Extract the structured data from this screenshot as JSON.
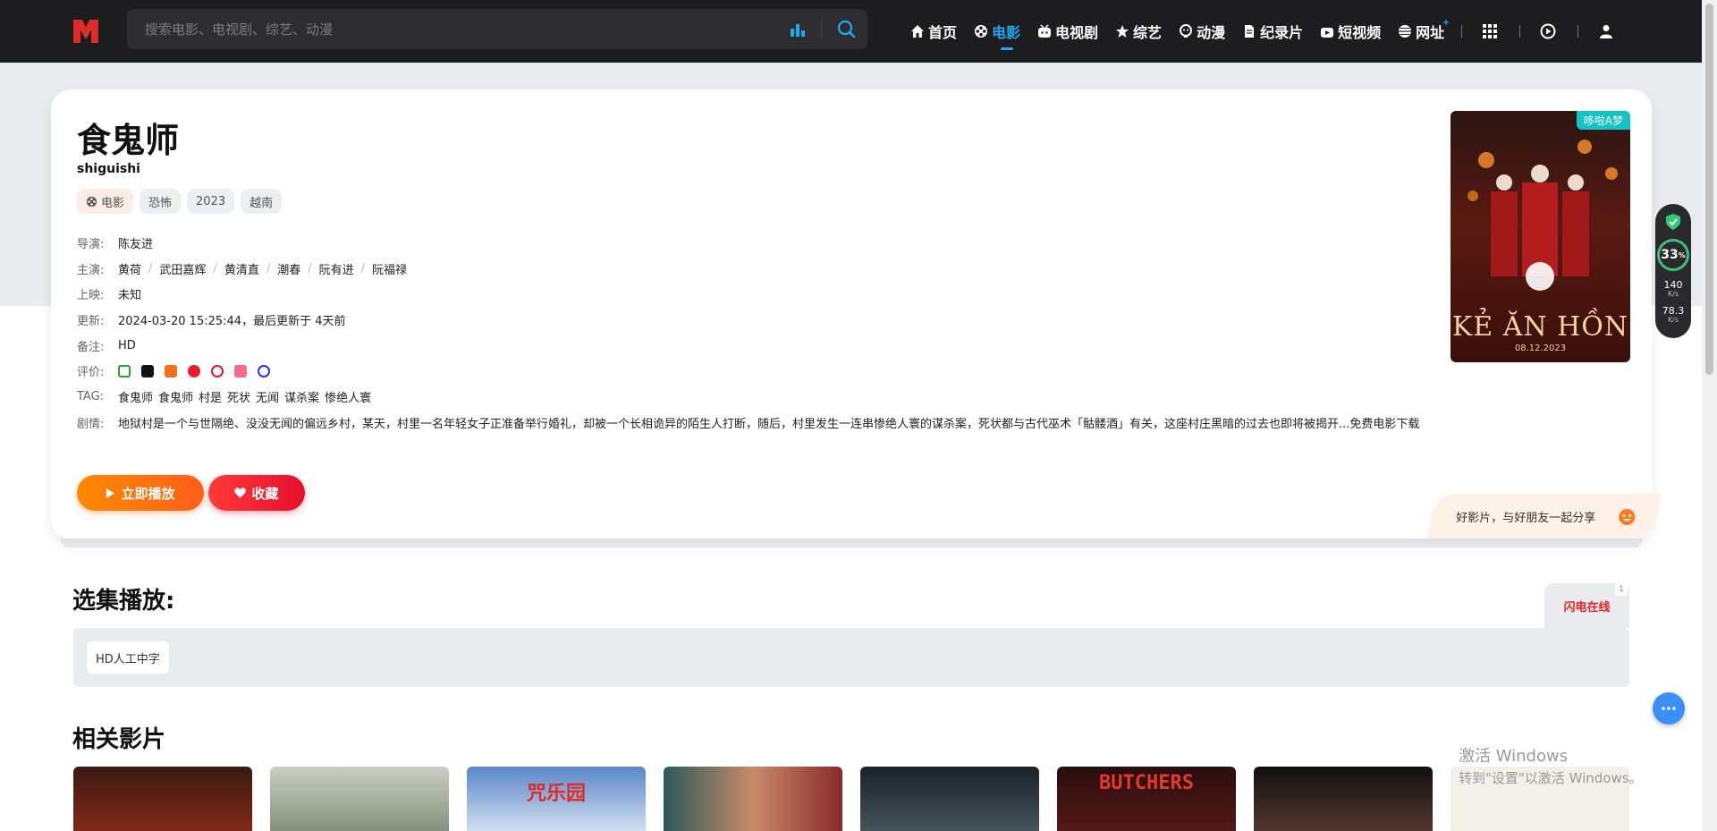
{
  "search": {
    "placeholder": "搜索电影、电视剧、综艺、动漫"
  },
  "nav": {
    "items": [
      {
        "label": "首页",
        "icon": "home-icon"
      },
      {
        "label": "电影",
        "icon": "film-reel-icon",
        "active": true
      },
      {
        "label": "电视剧",
        "icon": "tv-icon"
      },
      {
        "label": "综艺",
        "icon": "star-icon"
      },
      {
        "label": "动漫",
        "icon": "anime-face-icon"
      },
      {
        "label": "纪录片",
        "icon": "document-icon"
      },
      {
        "label": "短视频",
        "icon": "short-video-icon"
      },
      {
        "label": "网址",
        "icon": "globe-icon",
        "badge": "+"
      }
    ]
  },
  "movie": {
    "title": "食鬼师",
    "subtitle": "shiguishi",
    "tags": [
      "电影",
      "恐怖",
      "2023",
      "越南"
    ],
    "director_label": "导演:",
    "director": "陈友进",
    "cast_label": "主演:",
    "cast": [
      "黄荷",
      "武田嘉辉",
      "黄清直",
      "潮春",
      "阮有进",
      "阮福禄"
    ],
    "release_label": "上映:",
    "release": "未知",
    "updated_label": "更新:",
    "updated": "2024-03-20 15:25:44，最后更新于 4天前",
    "note_label": "备注:",
    "note": "HD",
    "rating_label": "评价:",
    "rating_icons": [
      "douban-icon",
      "douyin-icon",
      "toutiao-icon",
      "youku-icon",
      "weibo-icon",
      "bilibili-icon",
      "baidu-icon"
    ],
    "tag_label": "TAG:",
    "tag_links": [
      "食鬼师",
      "食鬼师",
      "村是",
      "死状",
      "无闻",
      "谋杀案",
      "惨绝人寰"
    ],
    "plot_label": "剧情:",
    "plot": "地狱村是一个与世隔绝、没没无闻的偏远乡村，某天，村里一名年轻女子正准备举行婚礼，却被一个长相诡异的陌生人打断，随后，村里发生一连串惨绝人寰的谋杀案，死状都与古代巫术「骷髅酒」有关，这座村庄黑暗的过去也即将被揭开...免费电影下载",
    "play_label": "立即播放",
    "fav_label": "收藏",
    "share_text": "好影片，与好朋友一起分享",
    "poster_badge": "哆啦A梦",
    "poster_title": "KẺ ĂN HỒN",
    "poster_sub": "08.12.2023"
  },
  "widget": {
    "percent": "33",
    "percent_unit": "%",
    "up": "140",
    "down": "78.3",
    "unit": "K/s"
  },
  "episodes": {
    "title": "选集播放:",
    "source_label": "闪电在线",
    "source_count": "1",
    "items": [
      "HD人工中字"
    ]
  },
  "related": {
    "title": "相关影片",
    "thumb_texts": [
      "",
      "",
      "咒乐园",
      "",
      "",
      "BUTCHERS",
      "",
      ""
    ]
  },
  "watermark": {
    "line1": "激活 Windows",
    "line2": "转到\"设置\"以激活 Windows。"
  },
  "colors": {
    "accent": "#1fa9f4",
    "play": "#ff7a00",
    "fav": "#ef1a33",
    "topbar": "#1d1d1f"
  }
}
